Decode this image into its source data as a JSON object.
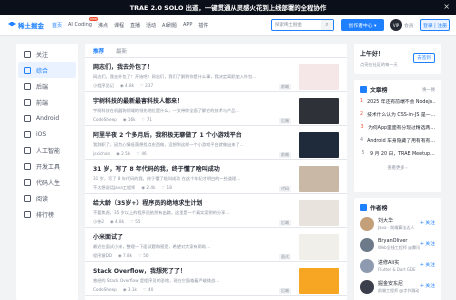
{
  "banner": {
    "text": "TRAE 2.0 SOLO 出道，一键贯通从灵感火花到上线部署的全程协作",
    "close": "×"
  },
  "header": {
    "logo_text": "稀土掘金",
    "nav": [
      {
        "label": "首页",
        "active": true,
        "badge": ""
      },
      {
        "label": "AI Coding",
        "active": false,
        "badge": "new"
      },
      {
        "label": "沸点",
        "active": false,
        "badge": ""
      },
      {
        "label": "课程",
        "active": false,
        "badge": ""
      },
      {
        "label": "直播",
        "active": false,
        "badge": ""
      },
      {
        "label": "活动",
        "active": false,
        "badge": ""
      },
      {
        "label": "AI刷题",
        "active": false,
        "badge": ""
      },
      {
        "label": "APP",
        "active": false,
        "badge": ""
      },
      {
        "label": "插件",
        "active": false,
        "badge": ""
      }
    ],
    "search_placeholder": "探索稀土掘金",
    "create_label": "创作者中心 ▾",
    "vip_badge": "VIP",
    "vip_label": "会员",
    "login_label": "登录 | 注册"
  },
  "sidebar": {
    "items": [
      {
        "label": "关注",
        "active": false,
        "name": "follow"
      },
      {
        "label": "综合",
        "active": true,
        "name": "general"
      },
      {
        "label": "后端",
        "active": false,
        "name": "backend"
      },
      {
        "label": "前端",
        "active": false,
        "name": "frontend"
      },
      {
        "label": "Android",
        "active": false,
        "name": "android"
      },
      {
        "label": "iOS",
        "active": false,
        "name": "ios"
      },
      {
        "label": "人工智能",
        "active": false,
        "name": "ai"
      },
      {
        "label": "开发工具",
        "active": false,
        "name": "devtools"
      },
      {
        "label": "代码人生",
        "active": false,
        "name": "code-life"
      },
      {
        "label": "阅读",
        "active": false,
        "name": "reading"
      },
      {
        "label": "排行榜",
        "active": false,
        "name": "ranking"
      }
    ]
  },
  "feed": {
    "tabs": [
      {
        "label": "推荐",
        "active": true
      },
      {
        "label": "最新",
        "active": false
      }
    ],
    "articles": [
      {
        "title": "网志们，我去外包了！",
        "brief": "网志们，我去外包了！开始吧！网志们，我们了解到你是什么事，我决定离职加入外包…",
        "author": "小程序员记",
        "views": "4.8k",
        "likes": "237",
        "tag": "前端",
        "thumb": "#f5e6e8"
      },
      {
        "title": "宇树科技的最新最害科技人都来！",
        "brief": "宇树科技在机器狗领域的领先地位是什么，一文带你全面了解它的技术与产品…",
        "author": "CodeSheep",
        "views": "16k",
        "likes": "71",
        "tag": "后端",
        "thumb": "#2e3138"
      },
      {
        "title": "阿里半夜 2 个多月后，我积极无聊做了 1 个小游戏平台",
        "brief": "我辞职了，因为心情低落想找点东西做，没想到这样一个小游戏平台就做出来了…",
        "author": "jsxichan",
        "views": "2.5k",
        "likes": "46",
        "tag": "前端",
        "thumb": "#1f2a3a"
      },
      {
        "title": "31 岁，写了 8 年代码的我，终于懂了啥叫成功",
        "brief": "31 岁，写了 8 年代码的我，终于懂了啥叫成功 在这个年纪才明白的一些道理…",
        "author": "不太想说话Java工程师",
        "views": "2.4k",
        "likes": "18",
        "tag": "代码",
        "thumb": "#c9b8a6"
      },
      {
        "title": "给大龄（35岁+）程序员的绝地求生计划",
        "brief": "不要焦虑，35 岁以上的程序员依然有出路，这里是一个真实案例的分享…",
        "author": "小伟2",
        "views": "4.8k",
        "likes": "55",
        "tag": "后端",
        "thumb": "#e8e4dd"
      },
      {
        "title": "小米面试了",
        "brief": "最近在面试小米，整理一下面试题和感受，希望对大家有帮助…",
        "author": "程序猿DD",
        "views": "7.8k",
        "likes": "50",
        "tag": "面试",
        "thumb": "#f1efe9"
      },
      {
        "title": "Stack Overflow，我想死了了！",
        "brief": "曾经的 Stack Overflow 是程序员的圣地，现在它面临着严峻挑战…",
        "author": "CodeSheep",
        "views": "3.1k",
        "likes": "40",
        "tag": "后端",
        "thumb": "#f6a623"
      }
    ]
  },
  "checkin": {
    "title": "上午好！",
    "subtitle": "点亮在社区的每一天",
    "button": "去签到"
  },
  "ranking": {
    "title": "文章榜",
    "more": "换一换",
    "items": [
      {
        "rank": "1",
        "text": "2025 年还有前端不会 Nodejs…"
      },
      {
        "rank": "2",
        "text": "技术什么认为 CSS-in-JS 是一…"
      },
      {
        "rank": "3",
        "text": "为何App里面有分现过精选两…"
      },
      {
        "rank": "4",
        "text": "Android 车身隐藏了用有有有…"
      },
      {
        "rank": "5",
        "text": "9 月 20 日，TRAE Meetup…"
      }
    ],
    "view_more": "查看更多 ›"
  },
  "authors": {
    "title": "作者榜",
    "items": [
      {
        "name": "刘大华",
        "desc": "Java · 前端算法达人",
        "follow": "+ 关注",
        "color": "#c4a07a"
      },
      {
        "name": "BryanOliver",
        "desc": "Web全栈工程师 @腾讯",
        "follow": "+ 关注",
        "color": "#6c7a89"
      },
      {
        "name": "进修Ali实",
        "desc": "Flutter & Dart GDE",
        "follow": "+ 关注",
        "color": "#8e9aaf"
      },
      {
        "name": "掘金安东尼",
        "desc": "前端工程师 @字节跳动",
        "follow": "+ 关注",
        "color": "#3a3f4b"
      }
    ]
  }
}
